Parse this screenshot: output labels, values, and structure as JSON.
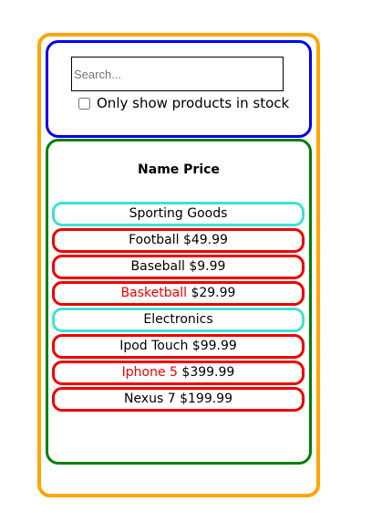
{
  "search": {
    "placeholder": "Search...",
    "stock_label": "Only show products in stock"
  },
  "table": {
    "header_name": "Name",
    "header_price": "Price",
    "rows": [
      {
        "type": "category",
        "label": "Sporting Goods"
      },
      {
        "type": "product",
        "name": "Football",
        "price": "$49.99",
        "in_stock": true
      },
      {
        "type": "product",
        "name": "Baseball",
        "price": "$9.99",
        "in_stock": true
      },
      {
        "type": "product",
        "name": "Basketball",
        "price": "$29.99",
        "in_stock": false
      },
      {
        "type": "category",
        "label": "Electronics"
      },
      {
        "type": "product",
        "name": "Ipod Touch",
        "price": "$99.99",
        "in_stock": true
      },
      {
        "type": "product",
        "name": "Iphone 5",
        "price": "$399.99",
        "in_stock": false
      },
      {
        "type": "product",
        "name": "Nexus 7",
        "price": "$199.99",
        "in_stock": true
      }
    ]
  },
  "colors": {
    "outer_border": "#ffa500",
    "search_border": "#0000ee",
    "table_border": "#008000",
    "category_border": "#40e0d0",
    "product_border": "#ee0000",
    "out_of_stock_text": "#ee0000"
  }
}
